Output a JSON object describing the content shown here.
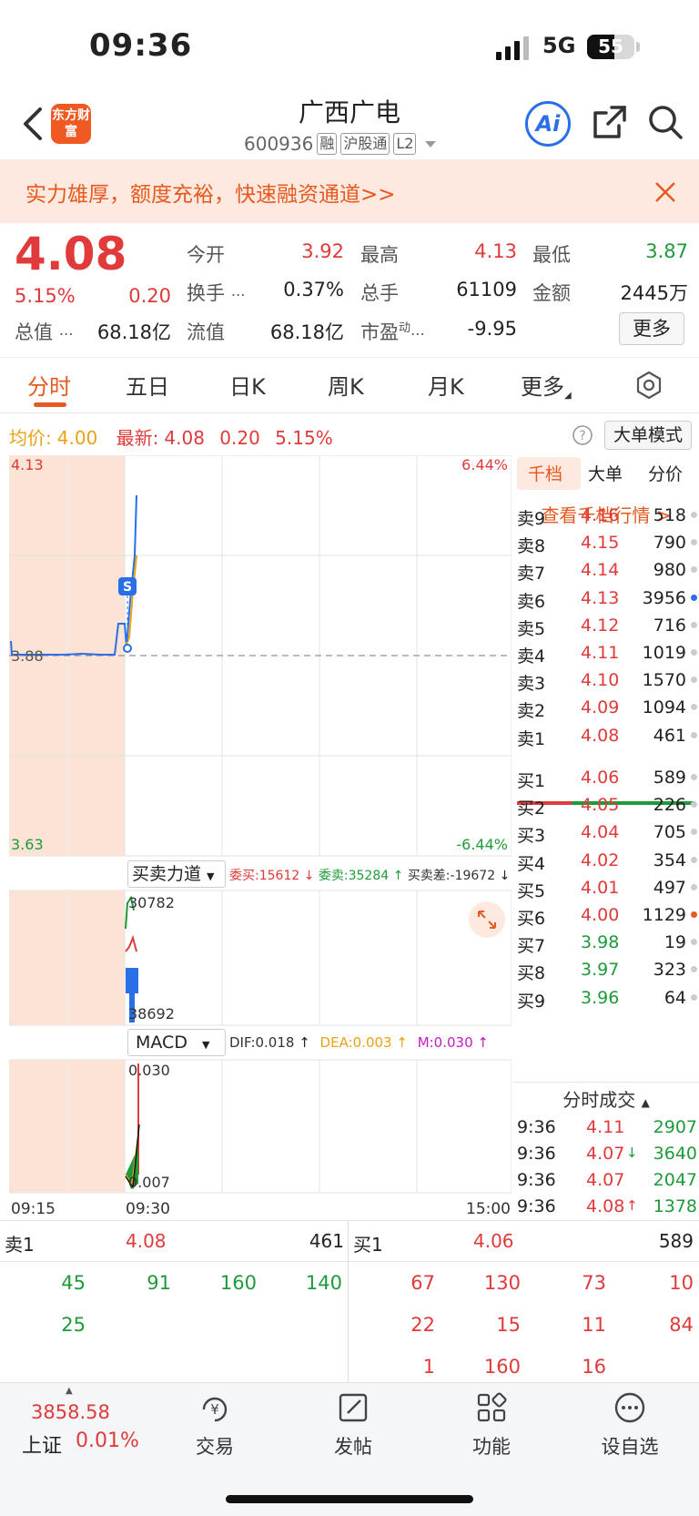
{
  "status": {
    "time": "09:36",
    "network": "5G",
    "battery": "55"
  },
  "header": {
    "title": "广西广电",
    "code": "600936",
    "tags": [
      "融",
      "沪股通",
      "L2"
    ],
    "logo_text": "东方财富",
    "ai_label": "Ai"
  },
  "banner": {
    "text": "实力雄厚，额度充裕，快速融资通道>>"
  },
  "quote": {
    "price": "4.08",
    "pct": "5.15%",
    "chg": "0.20",
    "items": [
      {
        "label": "今开",
        "value": "3.92"
      },
      {
        "label": "最高",
        "value": "4.13"
      },
      {
        "label": "最低",
        "value": "3.87"
      },
      {
        "label": "换手",
        "value": "0.37%"
      },
      {
        "label": "总手",
        "value": "61109"
      },
      {
        "label": "金额",
        "value": "2445万"
      },
      {
        "label": "总值",
        "value": "68.18亿"
      },
      {
        "label": "流值",
        "value": "68.18亿"
      },
      {
        "label": "市盈",
        "sup": "动",
        "value": "-9.95"
      }
    ],
    "more_label": "更多"
  },
  "tabs": [
    "分时",
    "五日",
    "日K",
    "周K",
    "月K",
    "更多"
  ],
  "chart_info": {
    "avg_label": "均价:",
    "avg_value": "4.00",
    "latest_label": "最新:",
    "latest_value": "4.08",
    "latest_chg": "0.20",
    "latest_pct": "5.15%",
    "big_order_mode": "大单模式"
  },
  "chart_data": {
    "type": "line",
    "price_top": "4.13",
    "price_base": "3.88",
    "price_bottom": "3.63",
    "pct_top": "6.44%",
    "pct_bottom": "-6.44%",
    "marker": "S",
    "volume_indicator": "买卖力道",
    "volume_stats": {
      "buy": "委买:15612",
      "sell": "委卖:35284",
      "diff": "买卖差:-19672"
    },
    "volume_top": "30782",
    "volume_bottom": "38692",
    "macd_label": "MACD",
    "macd_stats": {
      "dif": "DIF:0.018",
      "dea": "DEA:0.003",
      "m": "M:0.030"
    },
    "macd_top": "0.030",
    "macd_bottom": "0.007",
    "time_axis": [
      "09:15",
      "09:30",
      "15:00"
    ]
  },
  "side_tabs": [
    "千档",
    "大单",
    "分价"
  ],
  "depth_link": "查看千档行情 >",
  "asks": [
    {
      "label": "卖9",
      "price": "4.16",
      "vol": "518"
    },
    {
      "label": "卖8",
      "price": "4.15",
      "vol": "790"
    },
    {
      "label": "卖7",
      "price": "4.14",
      "vol": "980"
    },
    {
      "label": "卖6",
      "price": "4.13",
      "vol": "3956"
    },
    {
      "label": "卖5",
      "price": "4.12",
      "vol": "716"
    },
    {
      "label": "卖4",
      "price": "4.11",
      "vol": "1019"
    },
    {
      "label": "卖3",
      "price": "4.10",
      "vol": "1570"
    },
    {
      "label": "卖2",
      "price": "4.09",
      "vol": "1094"
    },
    {
      "label": "卖1",
      "price": "4.08",
      "vol": "461"
    }
  ],
  "bids": [
    {
      "label": "买1",
      "price": "4.06",
      "vol": "589"
    },
    {
      "label": "买2",
      "price": "4.05",
      "vol": "226"
    },
    {
      "label": "买3",
      "price": "4.04",
      "vol": "705"
    },
    {
      "label": "买4",
      "price": "4.02",
      "vol": "354"
    },
    {
      "label": "买5",
      "price": "4.01",
      "vol": "497"
    },
    {
      "label": "买6",
      "price": "4.00",
      "vol": "1129"
    },
    {
      "label": "买7",
      "price": "3.98",
      "vol": "19"
    },
    {
      "label": "买8",
      "price": "3.97",
      "vol": "323"
    },
    {
      "label": "买9",
      "price": "3.96",
      "vol": "64"
    }
  ],
  "ticks_title": "分时成交",
  "ticks": [
    {
      "time": "9:36",
      "price": "4.11",
      "arrow": "",
      "vol": "2907"
    },
    {
      "time": "9:36",
      "price": "4.07",
      "arrow": "↓",
      "vol": "3640"
    },
    {
      "time": "9:36",
      "price": "4.07",
      "arrow": "",
      "vol": "2047"
    },
    {
      "time": "9:36",
      "price": "4.08",
      "arrow": "↑",
      "vol": "1378"
    }
  ],
  "queue": {
    "sell_label": "卖1",
    "sell_price": "4.08",
    "sell_total": "461",
    "buy_label": "买1",
    "buy_price": "4.06",
    "buy_total": "589",
    "sell_orders": [
      [
        "45",
        "91",
        "160",
        "140"
      ],
      [
        "25"
      ]
    ],
    "buy_orders": [
      [
        "67",
        "130",
        "73",
        "10"
      ],
      [
        "22",
        "15",
        "11",
        "84"
      ],
      [
        "1",
        "160",
        "16"
      ]
    ]
  },
  "bottom_nav": {
    "index_value": "3858.58",
    "index_name": "上证",
    "index_pct": "0.01%",
    "items": [
      "交易",
      "发帖",
      "功能",
      "设自选"
    ]
  }
}
